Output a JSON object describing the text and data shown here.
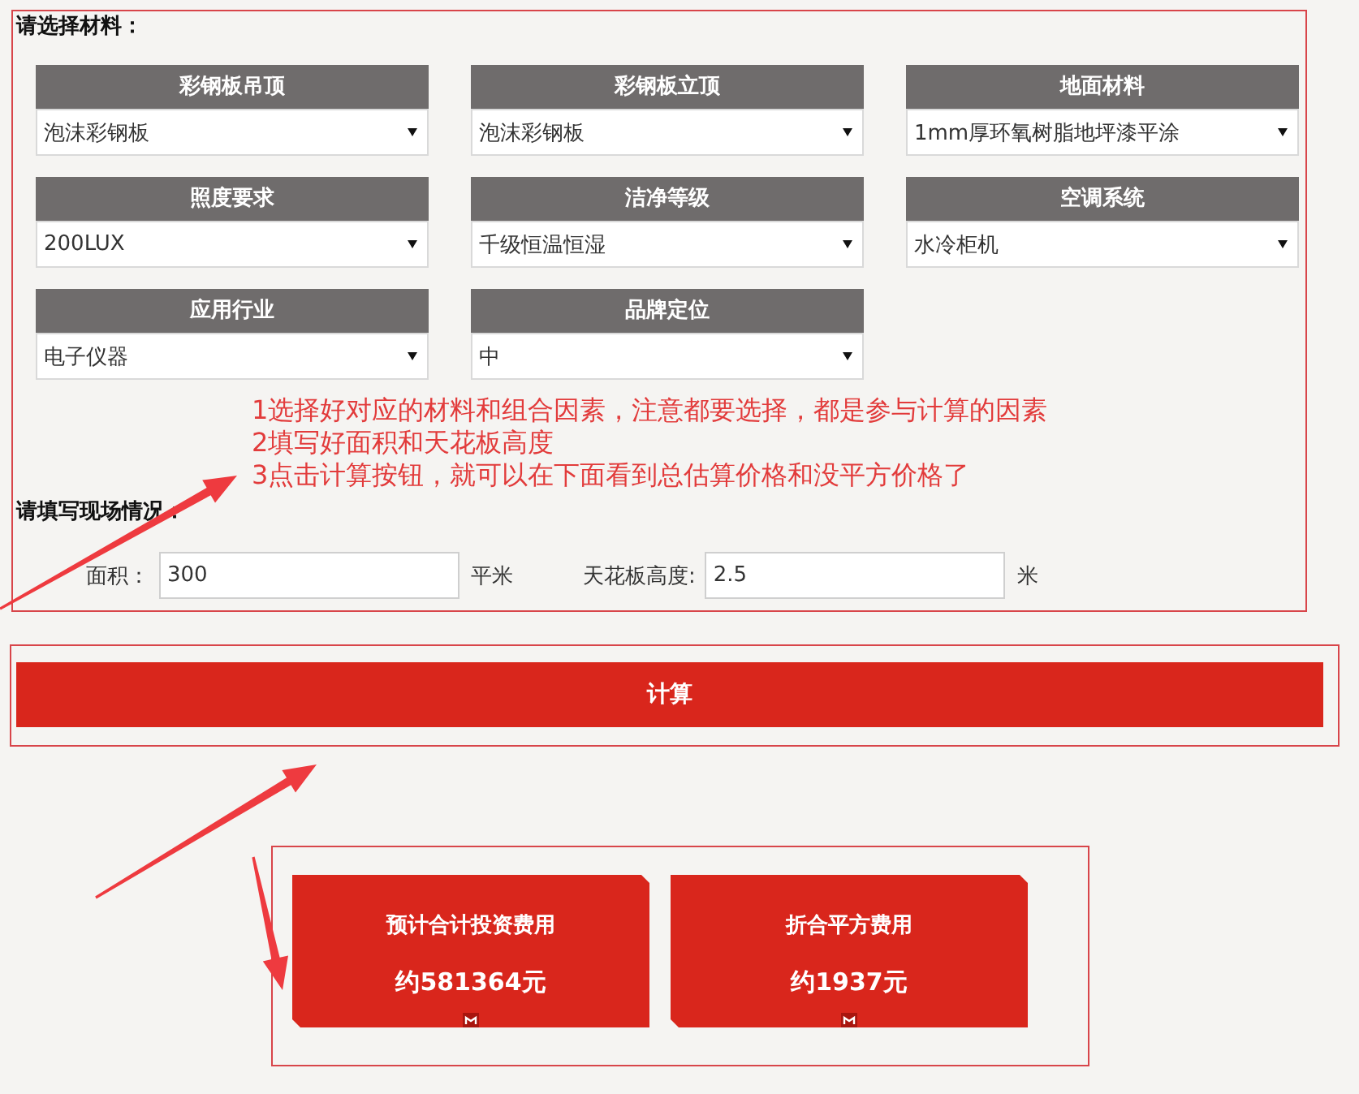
{
  "materials": {
    "title": "请选择材料：",
    "fields": [
      {
        "label": "彩钢板吊顶",
        "value": "泡沫彩钢板"
      },
      {
        "label": "彩钢板立顶",
        "value": "泡沫彩钢板"
      },
      {
        "label": "地面材料",
        "value": "1mm厚环氧树脂地坪漆平涂"
      },
      {
        "label": "照度要求",
        "value": "200LUX"
      },
      {
        "label": "洁净等级",
        "value": "千级恒温恒湿"
      },
      {
        "label": "空调系统",
        "value": "水冷柜机"
      },
      {
        "label": "应用行业",
        "value": "电子仪器"
      },
      {
        "label": "品牌定位",
        "value": "中"
      }
    ]
  },
  "instructions": [
    "1选择好对应的材料和组合因素，注意都要选择，都是参与计算的因素",
    "2填写好面积和天花板高度",
    "3点击计算按钮，就可以在下面看到总估算价格和没平方价格了"
  ],
  "site": {
    "title": "请填写现场情况：",
    "fields": [
      {
        "label": "面积：",
        "value": "300",
        "unit": "平米"
      },
      {
        "label": "天花板高度:",
        "value": "2.5",
        "unit": "米"
      }
    ]
  },
  "calculate_button": {
    "label": "计算"
  },
  "results": [
    {
      "title": "预计合计投资费用",
      "value": "约581364元"
    },
    {
      "title": "折合平方费用",
      "value": "约1937元"
    }
  ]
}
